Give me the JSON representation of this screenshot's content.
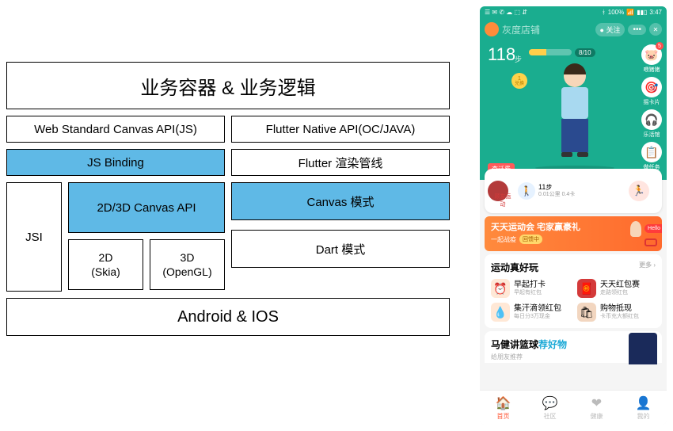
{
  "arch": {
    "business": "业务容器 & 业务逻辑",
    "web_canvas_api": "Web Standard Canvas API(JS)",
    "flutter_native_api": "Flutter Native API(OC/JAVA)",
    "js_binding": "JS Binding",
    "flutter_pipeline": "Flutter 渲染管线",
    "jsi": "JSI",
    "canvas_2d3d": "2D/3D Canvas API",
    "skia": "2D\n(Skia)",
    "opengl": "3D\n(OpenGL)",
    "canvas_mode": "Canvas 模式",
    "dart_mode": "Dart 模式",
    "platform": "Android & IOS"
  },
  "phone": {
    "statusbar": {
      "icons_left": "☰ ✉ ✆ ☁ ⬚ ⇵",
      "bt": "100%",
      "signal": "📶",
      "battery": "▮▮▯",
      "time": "3:47"
    },
    "header": {
      "shop_name": "灰度店铺",
      "follow": "● 关注",
      "more": "•••",
      "close": "✕"
    },
    "hero": {
      "steps": "118",
      "steps_unit": "步",
      "goal_badge": "8/10",
      "coin_value": "1",
      "coin_label": "兑换",
      "speech": "查话费",
      "side_icons": [
        {
          "emoji": "🐷",
          "label": "喂猪猪",
          "badge": "5"
        },
        {
          "emoji": "🎯",
          "label": "摇卡片",
          "badge": ""
        },
        {
          "emoji": "🎧",
          "label": "乐活馆",
          "badge": ""
        },
        {
          "emoji": "📋",
          "label": "做任务",
          "badge": ""
        }
      ]
    },
    "stats": {
      "avatar_label": "顾友运动",
      "steps_value": "11",
      "steps_unit": "步",
      "detail": "0.01公里  0.4卡",
      "run_glyph": "🏃"
    },
    "banner": {
      "title": "天天运动会 宅家赢豪礼",
      "sub": "一起战疫",
      "btn": "回馈中",
      "tag": "Hello"
    },
    "fun": {
      "title": "运动真好玩",
      "link": "更多 ›",
      "items": [
        {
          "icon": "⏰",
          "icon_bg": "#ffe8d6",
          "title": "早起打卡",
          "sub": "早起有红包"
        },
        {
          "icon": "🧧",
          "icon_bg": "#d43a3a",
          "title": "天天红包赛",
          "sub": "走路领红包"
        },
        {
          "icon": "💧",
          "icon_bg": "#ffe8d6",
          "title": "集汗滴领红包",
          "sub": "每日分3万现金"
        },
        {
          "icon": "🛍",
          "icon_bg": "#f2d6c0",
          "title": "购物抵现",
          "sub": "卡币充大额红包"
        }
      ]
    },
    "list": {
      "title_a": "马健讲篮球",
      "title_b": "荐好物",
      "sub": "给朋友推荐"
    },
    "tabs": [
      {
        "icon": "🏠",
        "label": "首页",
        "active": true
      },
      {
        "icon": "💬",
        "label": "社区",
        "active": false
      },
      {
        "icon": "❤",
        "label": "健康",
        "active": false
      },
      {
        "icon": "👤",
        "label": "我的",
        "active": false
      }
    ]
  }
}
